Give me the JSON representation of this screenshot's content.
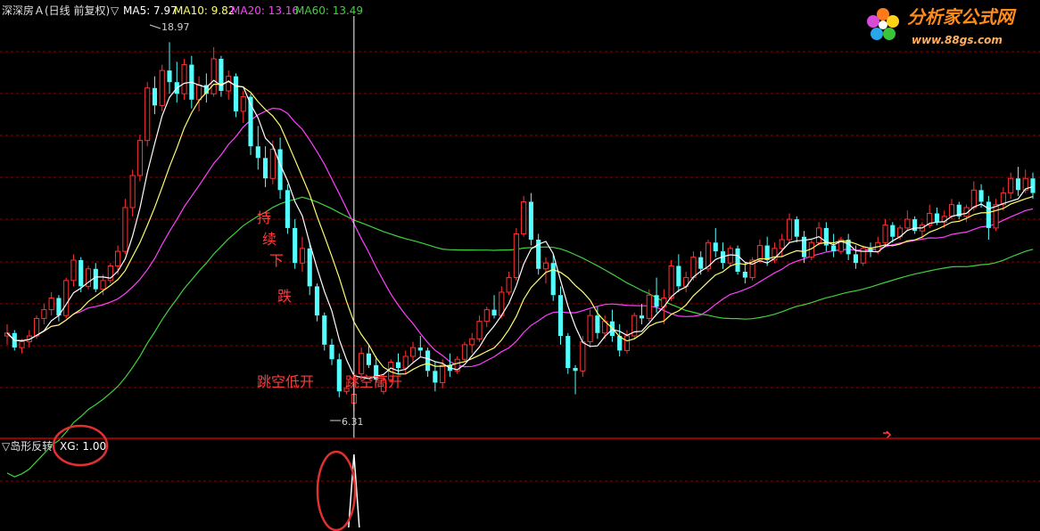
{
  "header": {
    "title": "深深房Ａ(日线 前复权)",
    "ma_marker": "▽",
    "ma5": "MA5: 7.97",
    "ma10": "MA10: 9.82",
    "ma20": "MA20: 13.16",
    "ma60": "MA60: 13.49"
  },
  "watermark": {
    "name": "分析家公式网",
    "url": "www.88gs.com"
  },
  "indicator": {
    "name": "▽岛形反转",
    "value": "XG: 1.00"
  },
  "annotations": {
    "continuous_drop": [
      "持",
      "续",
      "下",
      "跌"
    ],
    "gap_down": "跳空低开",
    "gap_up": "跳空高开"
  },
  "price_labels": {
    "high": "18.97",
    "low": "6.31"
  },
  "colors": {
    "up": "#ff3232",
    "down": "#54ffff",
    "ma5": "#ffffff",
    "ma10": "#ffff6e",
    "ma20": "#ff40ff",
    "ma60": "#3fd13f",
    "grid": "#8b0000",
    "separator": "#c80000",
    "annotation": "#ff3b3b",
    "circle": "#e03030"
  },
  "chart_data": {
    "type": "candlestick",
    "title": "深深房Ａ(日线 前复权)",
    "ylim": [
      6.0,
      19.5
    ],
    "max_label": 18.97,
    "min_label": 6.31,
    "candles": [
      [
        8.9,
        9.3,
        8.6,
        9.0
      ],
      [
        9.0,
        9.1,
        8.4,
        8.5
      ],
      [
        8.5,
        8.8,
        8.3,
        8.7
      ],
      [
        8.7,
        9.1,
        8.5,
        8.9
      ],
      [
        8.9,
        9.6,
        8.8,
        9.5
      ],
      [
        9.5,
        10.0,
        9.3,
        9.8
      ],
      [
        9.8,
        10.4,
        9.6,
        10.2
      ],
      [
        10.2,
        10.3,
        9.4,
        9.6
      ],
      [
        9.6,
        10.9,
        9.5,
        10.8
      ],
      [
        10.8,
        11.7,
        10.6,
        11.5
      ],
      [
        11.5,
        11.6,
        10.4,
        10.6
      ],
      [
        10.6,
        11.3,
        10.5,
        11.2
      ],
      [
        11.2,
        11.4,
        10.4,
        10.5
      ],
      [
        10.5,
        11.0,
        10.3,
        10.8
      ],
      [
        10.8,
        11.4,
        10.7,
        11.3
      ],
      [
        11.3,
        12.0,
        11.0,
        11.8
      ],
      [
        11.8,
        13.6,
        11.7,
        13.3
      ],
      [
        13.3,
        14.6,
        13.0,
        14.4
      ],
      [
        14.4,
        15.8,
        14.2,
        15.6
      ],
      [
        15.6,
        17.6,
        15.4,
        17.4
      ],
      [
        17.4,
        17.8,
        16.5,
        16.8
      ],
      [
        16.8,
        18.2,
        16.6,
        18.0
      ],
      [
        18.0,
        18.97,
        17.2,
        17.6
      ],
      [
        17.6,
        18.3,
        16.9,
        17.2
      ],
      [
        17.2,
        18.4,
        17.0,
        18.2
      ],
      [
        18.2,
        18.5,
        16.7,
        17.0
      ],
      [
        17.0,
        17.8,
        16.6,
        17.5
      ],
      [
        17.5,
        17.9,
        16.9,
        17.2
      ],
      [
        17.2,
        18.8,
        17.1,
        18.4
      ],
      [
        18.4,
        18.5,
        17.1,
        17.3
      ],
      [
        17.3,
        18.0,
        17.0,
        17.8
      ],
      [
        17.8,
        17.9,
        16.4,
        16.6
      ],
      [
        16.6,
        17.3,
        16.2,
        17.1
      ],
      [
        17.1,
        17.2,
        15.1,
        15.4
      ],
      [
        15.4,
        16.1,
        14.6,
        15.0
      ],
      [
        15.0,
        15.4,
        14.0,
        14.3
      ],
      [
        14.3,
        15.6,
        14.1,
        15.3
      ],
      [
        15.3,
        15.7,
        13.6,
        13.9
      ],
      [
        13.9,
        14.1,
        12.4,
        12.6
      ],
      [
        12.6,
        12.9,
        11.2,
        11.4
      ],
      [
        11.4,
        12.3,
        11.1,
        11.9
      ],
      [
        11.9,
        12.1,
        10.3,
        10.6
      ],
      [
        10.6,
        10.7,
        9.4,
        9.6
      ],
      [
        9.6,
        9.7,
        8.4,
        8.6
      ],
      [
        8.6,
        8.8,
        7.9,
        8.1
      ],
      [
        8.1,
        8.3,
        6.8,
        7.0
      ],
      [
        7.0,
        7.2,
        6.9,
        7.1
      ],
      [
        6.6,
        7.1,
        6.31,
        6.9
      ],
      [
        7.6,
        8.5,
        7.5,
        8.3
      ],
      [
        8.3,
        8.6,
        7.8,
        7.9
      ],
      [
        7.9,
        8.2,
        7.3,
        7.4
      ],
      [
        7.0,
        7.6,
        6.9,
        7.4
      ],
      [
        7.4,
        8.1,
        7.3,
        8.0
      ],
      [
        8.0,
        8.3,
        7.6,
        7.8
      ],
      [
        7.8,
        8.4,
        7.6,
        8.2
      ],
      [
        8.2,
        8.7,
        8.0,
        8.5
      ],
      [
        8.5,
        8.9,
        8.2,
        8.4
      ],
      [
        8.4,
        8.5,
        7.5,
        7.7
      ],
      [
        7.7,
        8.0,
        7.0,
        7.3
      ],
      [
        7.3,
        8.1,
        7.1,
        7.9
      ],
      [
        7.9,
        8.3,
        7.5,
        7.7
      ],
      [
        7.7,
        8.2,
        7.6,
        8.1
      ],
      [
        8.1,
        8.7,
        8.0,
        8.6
      ],
      [
        8.6,
        9.0,
        8.3,
        8.8
      ],
      [
        8.8,
        9.6,
        8.7,
        9.4
      ],
      [
        9.4,
        9.9,
        9.2,
        9.8
      ],
      [
        9.8,
        10.3,
        9.5,
        9.6
      ],
      [
        9.6,
        10.6,
        9.5,
        10.4
      ],
      [
        10.4,
        11.1,
        10.3,
        10.9
      ],
      [
        10.9,
        12.6,
        10.8,
        12.4
      ],
      [
        12.4,
        13.7,
        12.3,
        13.5
      ],
      [
        13.5,
        13.8,
        12.0,
        12.2
      ],
      [
        12.2,
        12.4,
        11.0,
        11.2
      ],
      [
        11.2,
        11.6,
        10.7,
        11.4
      ],
      [
        11.4,
        11.7,
        10.1,
        10.3
      ],
      [
        10.3,
        10.6,
        8.6,
        8.9
      ],
      [
        8.9,
        9.0,
        7.6,
        7.8
      ],
      [
        7.8,
        7.9,
        6.9,
        7.7
      ],
      [
        7.7,
        8.9,
        7.5,
        8.7
      ],
      [
        8.7,
        9.8,
        8.5,
        9.6
      ],
      [
        9.6,
        9.9,
        8.8,
        9.0
      ],
      [
        9.0,
        9.6,
        8.8,
        9.4
      ],
      [
        9.4,
        9.8,
        8.7,
        8.9
      ],
      [
        8.9,
        9.3,
        8.2,
        8.4
      ],
      [
        8.4,
        9.1,
        8.3,
        8.9
      ],
      [
        8.9,
        9.7,
        8.8,
        9.6
      ],
      [
        9.6,
        10.0,
        9.3,
        9.5
      ],
      [
        9.5,
        10.5,
        9.4,
        10.3
      ],
      [
        10.3,
        10.9,
        9.7,
        9.9
      ],
      [
        9.9,
        10.5,
        9.3,
        10.2
      ],
      [
        10.2,
        11.5,
        10.1,
        11.3
      ],
      [
        11.3,
        11.7,
        10.4,
        10.6
      ],
      [
        10.6,
        11.1,
        10.4,
        10.9
      ],
      [
        10.9,
        11.8,
        10.8,
        11.6
      ],
      [
        11.6,
        11.8,
        11.0,
        11.2
      ],
      [
        11.2,
        12.2,
        11.1,
        12.1
      ],
      [
        12.1,
        12.6,
        11.6,
        11.8
      ],
      [
        11.8,
        12.1,
        11.2,
        11.4
      ],
      [
        11.4,
        12.0,
        11.3,
        11.9
      ],
      [
        11.9,
        12.0,
        11.0,
        11.1
      ],
      [
        11.1,
        11.4,
        10.7,
        10.9
      ],
      [
        10.9,
        11.6,
        10.8,
        11.5
      ],
      [
        11.5,
        12.2,
        11.4,
        12.0
      ],
      [
        12.0,
        12.3,
        11.3,
        11.5
      ],
      [
        11.5,
        12.1,
        11.4,
        11.9
      ],
      [
        11.9,
        12.4,
        11.6,
        12.2
      ],
      [
        12.2,
        13.1,
        12.1,
        12.9
      ],
      [
        12.9,
        13.0,
        12.1,
        12.3
      ],
      [
        12.3,
        12.5,
        11.4,
        11.6
      ],
      [
        11.6,
        12.2,
        11.5,
        12.1
      ],
      [
        12.1,
        12.8,
        12.0,
        12.6
      ],
      [
        12.6,
        12.8,
        11.8,
        12.0
      ],
      [
        12.0,
        12.4,
        11.6,
        11.8
      ],
      [
        11.8,
        12.3,
        11.7,
        12.2
      ],
      [
        12.2,
        12.4,
        11.5,
        11.7
      ],
      [
        11.7,
        12.0,
        11.2,
        11.4
      ],
      [
        11.4,
        12.0,
        11.3,
        11.9
      ],
      [
        11.9,
        12.1,
        11.6,
        11.8
      ],
      [
        11.8,
        12.3,
        11.7,
        12.1
      ],
      [
        12.1,
        12.9,
        12.0,
        12.7
      ],
      [
        12.7,
        12.8,
        12.1,
        12.3
      ],
      [
        12.3,
        12.7,
        12.2,
        12.6
      ],
      [
        12.6,
        13.2,
        12.5,
        12.9
      ],
      [
        12.9,
        13.0,
        12.4,
        12.5
      ],
      [
        12.5,
        12.8,
        12.2,
        12.7
      ],
      [
        12.7,
        13.4,
        12.6,
        13.1
      ],
      [
        13.1,
        13.3,
        12.7,
        12.8
      ],
      [
        12.8,
        13.2,
        12.6,
        13.0
      ],
      [
        13.0,
        13.6,
        12.9,
        13.4
      ],
      [
        13.4,
        13.5,
        12.9,
        13.0
      ],
      [
        13.0,
        13.4,
        12.8,
        13.3
      ],
      [
        13.3,
        14.2,
        13.2,
        13.9
      ],
      [
        13.9,
        14.1,
        13.3,
        13.5
      ],
      [
        13.5,
        13.7,
        12.2,
        12.6
      ],
      [
        12.6,
        13.6,
        12.5,
        13.4
      ],
      [
        13.4,
        14.0,
        13.2,
        13.8
      ],
      [
        13.8,
        14.5,
        13.6,
        14.3
      ],
      [
        14.3,
        14.7,
        13.7,
        13.9
      ],
      [
        13.9,
        14.6,
        13.8,
        14.3
      ],
      [
        14.3,
        14.5,
        13.6,
        13.8
      ]
    ],
    "signal_index": 47
  }
}
